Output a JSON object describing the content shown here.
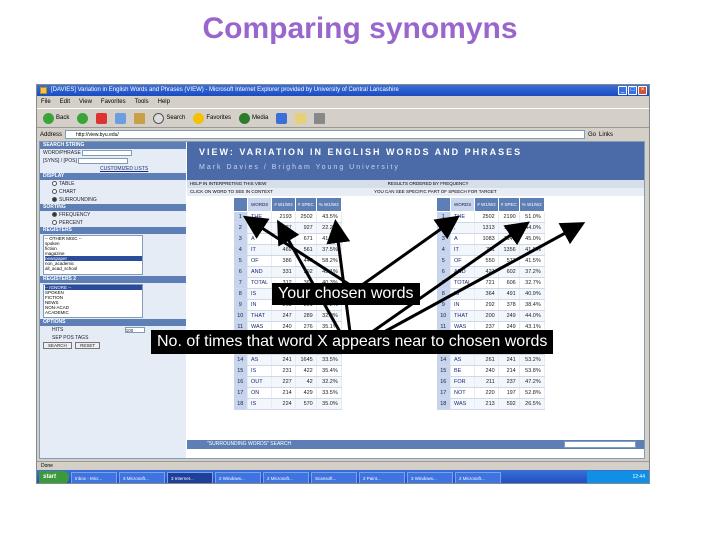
{
  "slide": {
    "title": "Comparing synomyns",
    "callout_chosen": "Your chosen words",
    "callout_times": "No. of times that word X appears near to chosen words"
  },
  "browser": {
    "window_title": "[DAVIES] Variation in English Words and Phrases (VIEW) - Microsoft Internet Explorer provided by University of Central Lancashire",
    "menu": [
      "File",
      "Edit",
      "View",
      "Favorites",
      "Tools",
      "Help"
    ],
    "toolbar": [
      "Back",
      "Search",
      "Favorites",
      "Media"
    ],
    "address_label": "Address",
    "address": "http://view.byu.edu/",
    "go_label": "Go",
    "links_label": "Links"
  },
  "left_panel": {
    "search_string_head": "SEARCH STRING",
    "word_phrase_label": "WORD/PHRASE",
    "word_phrase_value": "sun|strange",
    "syns_label": "[SYNS] / [POS]",
    "customized_lists": "CUSTOMIZED LISTS",
    "display_head": "DISPLAY",
    "display_options": [
      "TABLE",
      "CHART",
      "SURROUNDING"
    ],
    "sort_head": "SORTING",
    "sort_options": [
      "FREQUENCY",
      "PERCENT"
    ],
    "registers_head": "REGISTERS",
    "registers_list": [
      "-- OTHER MISC --",
      "spoken",
      "fiction",
      "magazine",
      "newspaper",
      "non_academic",
      "all_acad_school"
    ],
    "registers2_head": "REGISTERS 2",
    "registers2_list": [
      "-- IGNORE --",
      "SPOKEN",
      "FICTION",
      "NEWS",
      "NON-ACAD",
      "ACADEMIC"
    ],
    "options_head": "OPTIONS",
    "hits_label": "HITS",
    "hits_value": "100",
    "sep_tags": "SEP POS TAGS",
    "buttons": [
      "SEARCH",
      "RESET"
    ]
  },
  "banner": {
    "title": "VIEW: VARIATION IN ENGLISH WORDS AND PHRASES",
    "subtitle": "Mark Davies / Brigham Young University"
  },
  "info": {
    "left_note": "HELP IN INTERPRETING THIS VIEW",
    "right_note": "RESULTS ORDERED BY FREQUENCY",
    "left_note2": "CLICK ON WORD TO SEE IN CONTEXT",
    "right_note2": "YOU CAN SEE SPECIFIC PART OF SPEECH FOR TARGET"
  },
  "table_left": {
    "headers": [
      "",
      "WORDS",
      "# W1/W2",
      "# SPEC",
      "% W1/W2"
    ],
    "rows": [
      {
        "n": "1",
        "w": "THE",
        "a": "2193",
        "b": "2502",
        "p": "43.5%"
      },
      {
        "n": "2",
        "w": ",",
        "a": "727",
        "b": "927",
        "p": "22.2%"
      },
      {
        "n": "3",
        "w": "A",
        "a": "543",
        "b": "671",
        "p": "41.0%"
      },
      {
        "n": "4",
        "w": "IT",
        "a": "469",
        "b": "561",
        "p": "37.5%"
      },
      {
        "n": "5",
        "w": "OF",
        "a": "386",
        "b": "447",
        "p": "58.2%"
      },
      {
        "n": "6",
        "w": "AND",
        "a": "331",
        "b": "392",
        "p": "43.1%"
      },
      {
        "n": "7",
        "w": "TOTAL",
        "a": "312",
        "b": "365",
        "p": "40.3%"
      },
      {
        "n": "8",
        "w": "IS",
        "a": "285",
        "b": "337",
        "p": "41.6%"
      },
      {
        "n": "9",
        "w": "IN",
        "a": "263",
        "b": "301",
        "p": "44.2%"
      },
      {
        "n": "10",
        "w": "THAT",
        "a": "247",
        "b": "289",
        "p": "32.0%"
      },
      {
        "n": "11",
        "w": "WAS",
        "a": "240",
        "b": "276",
        "p": "35.1%"
      },
      {
        "n": "12",
        "w": "TO",
        "a": "236",
        "b": "261",
        "p": "41.7%"
      },
      {
        "n": "13",
        "w": "HE",
        "a": "230",
        "b": "240",
        "p": "44.6%"
      },
      {
        "n": "14",
        "w": "AS",
        "a": "241",
        "b": "1645",
        "p": "33.5%"
      },
      {
        "n": "15",
        "w": "IS",
        "a": "231",
        "b": "422",
        "p": "35.4%"
      },
      {
        "n": "16",
        "w": "OUT",
        "a": "227",
        "b": "42",
        "p": "32.2%"
      },
      {
        "n": "17",
        "w": "ON",
        "a": "214",
        "b": "429",
        "p": "33.5%"
      },
      {
        "n": "18",
        "w": "IS",
        "a": "224",
        "b": "570",
        "p": "35.0%"
      }
    ]
  },
  "table_right": {
    "headers": [
      "",
      "WORDS",
      "# W1/W2",
      "# SPEC",
      "% W1/W2"
    ],
    "rows": [
      {
        "n": "1",
        "w": "THE",
        "a": "2502",
        "b": "2190",
        "p": "51.0%"
      },
      {
        "n": "2",
        "w": ",",
        "a": "1313",
        "b": "1100",
        "p": "44.0%"
      },
      {
        "n": "3",
        "w": "A",
        "a": "1083",
        "b": "1142",
        "p": "45.0%"
      },
      {
        "n": "4",
        "w": "IT",
        "a": "711",
        "b": "1356",
        "p": "41.9%"
      },
      {
        "n": "5",
        "w": "OF",
        "a": "550",
        "b": "571",
        "p": "41.5%"
      },
      {
        "n": "6",
        "w": "AND",
        "a": "421",
        "b": "602",
        "p": "37.2%"
      },
      {
        "n": "7",
        "w": "TOTAL",
        "a": "721",
        "b": "606",
        "p": "32.7%"
      },
      {
        "n": "8",
        "w": "IS",
        "a": "364",
        "b": "491",
        "p": "40.9%"
      },
      {
        "n": "9",
        "w": "IN",
        "a": "292",
        "b": "378",
        "p": "38.4%"
      },
      {
        "n": "10",
        "w": "THAT",
        "a": "200",
        "b": "249",
        "p": "44.0%"
      },
      {
        "n": "11",
        "w": "WAS",
        "a": "237",
        "b": "249",
        "p": "43.1%"
      },
      {
        "n": "12",
        "w": "TO",
        "a": "265",
        "b": "290",
        "p": "47.7%"
      },
      {
        "n": "13",
        "w": "HE",
        "a": "251",
        "b": "331",
        "p": "38.4%"
      },
      {
        "n": "14",
        "w": "AS",
        "a": "261",
        "b": "241",
        "p": "53.2%"
      },
      {
        "n": "15",
        "w": "BE",
        "a": "240",
        "b": "214",
        "p": "53.8%"
      },
      {
        "n": "16",
        "w": "FOR",
        "a": "211",
        "b": "237",
        "p": "47.2%"
      },
      {
        "n": "17",
        "w": "NOT",
        "a": "220",
        "b": "197",
        "p": "52.8%"
      },
      {
        "n": "18",
        "w": "WAS",
        "a": "213",
        "b": "592",
        "p": "26.5%"
      }
    ]
  },
  "search_bar": "\"SURROUNDING WORDS\" SEARCH",
  "status": "Done",
  "taskbar": {
    "start": "start",
    "tasks": [
      "Inbox - Micr...",
      "3 Microsoft...",
      "3 Internet...",
      "2 Windows...",
      "2 Microsoft...",
      "Scansoft...",
      "2 Paint...",
      "3 Windows...",
      "2 Microsoft..."
    ],
    "active_index": 2,
    "tray": "12:44"
  },
  "colors": {
    "title": "#9966cc",
    "banner": "#4a6aa8",
    "header": "#5d7fb5"
  }
}
